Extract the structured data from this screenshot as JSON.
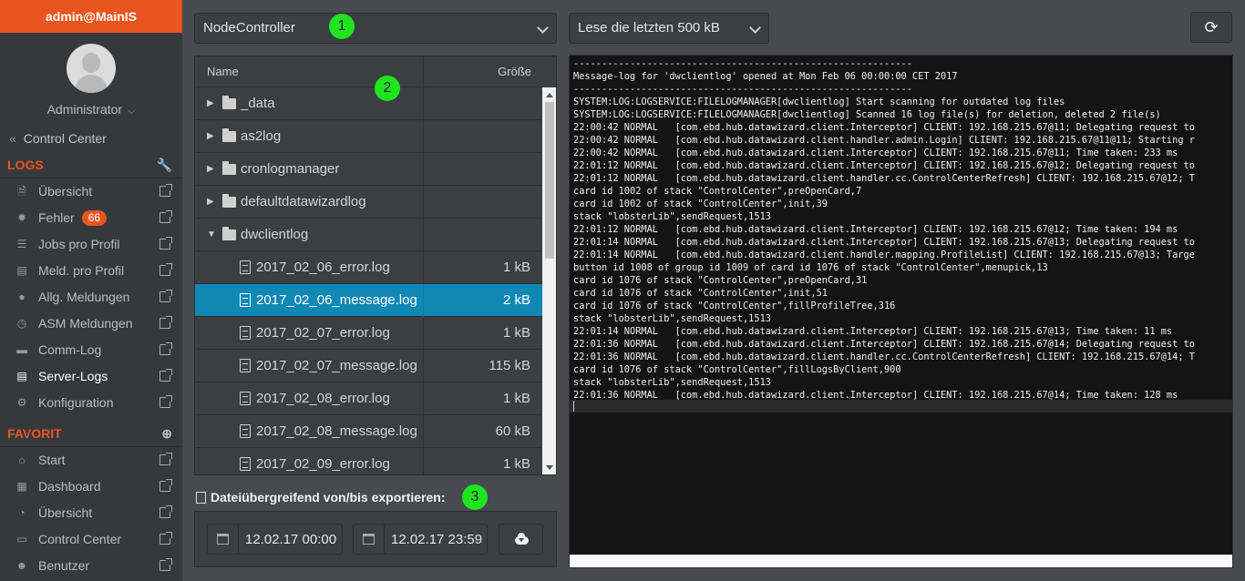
{
  "sidebar": {
    "user": "admin@MainIS",
    "role": "Administrator",
    "control_center": "Control Center",
    "sections": {
      "logs": "LOGS",
      "favorit": "FAVORIT"
    },
    "logs_items": [
      {
        "label": "Übersicht",
        "icon": "file-icon"
      },
      {
        "label": "Fehler",
        "icon": "bug-icon",
        "badge": "66"
      },
      {
        "label": "Jobs pro Profil",
        "icon": "page-icon"
      },
      {
        "label": "Meld. pro Profil",
        "icon": "book-icon"
      },
      {
        "label": "Allg. Meldungen",
        "icon": "globe-icon"
      },
      {
        "label": "ASM Meldungen",
        "icon": "clock-icon"
      },
      {
        "label": "Comm-Log",
        "icon": "database-icon"
      },
      {
        "label": "Server-Logs",
        "icon": "document-icon"
      },
      {
        "label": "Konfiguration",
        "icon": "cogs-icon"
      }
    ],
    "favorit_items": [
      {
        "label": "Start",
        "icon": "home-icon"
      },
      {
        "label": "Dashboard",
        "icon": "grid-icon"
      },
      {
        "label": "Übersicht",
        "icon": "pie-icon"
      },
      {
        "label": "Control Center",
        "icon": "monitor-icon"
      },
      {
        "label": "Benutzer",
        "icon": "users-icon"
      }
    ]
  },
  "toolbar": {
    "node_select": "NodeController",
    "read_select": "Lese die letzten 500 kB",
    "refresh_icon": "refresh-icon"
  },
  "annotations": [
    "1",
    "2",
    "3"
  ],
  "file_table": {
    "col_name": "Name",
    "col_size": "Größe",
    "rows": [
      {
        "type": "folder",
        "name": "_data",
        "size": ""
      },
      {
        "type": "folder",
        "name": "as2log",
        "size": ""
      },
      {
        "type": "folder",
        "name": "cronlogmanager",
        "size": ""
      },
      {
        "type": "folder",
        "name": "defaultdatawizardlog",
        "size": ""
      },
      {
        "type": "folder-open",
        "name": "dwclientlog",
        "size": ""
      },
      {
        "type": "file",
        "name": "2017_02_06_error.log",
        "size": "1 kB"
      },
      {
        "type": "file",
        "name": "2017_02_06_message.log",
        "size": "2 kB",
        "selected": true
      },
      {
        "type": "file",
        "name": "2017_02_07_error.log",
        "size": "1 kB"
      },
      {
        "type": "file",
        "name": "2017_02_07_message.log",
        "size": "115 kB"
      },
      {
        "type": "file",
        "name": "2017_02_08_error.log",
        "size": "1 kB"
      },
      {
        "type": "file",
        "name": "2017_02_08_message.log",
        "size": "60 kB"
      },
      {
        "type": "file",
        "name": "2017_02_09_error.log",
        "size": "1 kB"
      }
    ]
  },
  "export": {
    "title": "Dateiübergreifend von/bis exportieren:",
    "from_value": "12.02.17 00:00",
    "to_value": "12.02.17 23:59",
    "download_icon": "cloud-download-icon"
  },
  "log_lines": [
    "------------------------------------------------------------",
    "Message-log for 'dwclientlog' opened at Mon Feb 06 00:00:00 CET 2017",
    "------------------------------------------------------------",
    "SYSTEM:LOG:LOGSERVICE:FILELOGMANAGER[dwclientlog] Start scanning for outdated log files",
    "SYSTEM:LOG:LOGSERVICE:FILELOGMANAGER[dwclientlog] Scanned 16 log file(s) for deletion, deleted 2 file(s)",
    "22:00:42 NORMAL   [com.ebd.hub.datawizard.client.Interceptor] CLIENT: 192.168.215.67@11; Delegating request to",
    "22:00:42 NORMAL   [com.ebd.hub.datawizard.client.handler.admin.Login] CLIENT: 192.168.215.67@11@11; Starting r",
    "22:00:42 NORMAL   [com.ebd.hub.datawizard.client.Interceptor] CLIENT: 192.168.215.67@11; Time taken: 233 ms",
    "22:01:12 NORMAL   [com.ebd.hub.datawizard.client.Interceptor] CLIENT: 192.168.215.67@12; Delegating request to",
    "22:01:12 NORMAL   [com.ebd.hub.datawizard.client.handler.cc.ControlCenterRefresh] CLIENT: 192.168.215.67@12; T",
    "card id 1002 of stack \"ControlCenter\",preOpenCard,7",
    "card id 1002 of stack \"ControlCenter\",init,39",
    "stack \"lobsterLib\",sendRequest,1513",
    "22:01:12 NORMAL   [com.ebd.hub.datawizard.client.Interceptor] CLIENT: 192.168.215.67@12; Time taken: 194 ms",
    "22:01:14 NORMAL   [com.ebd.hub.datawizard.client.Interceptor] CLIENT: 192.168.215.67@13; Delegating request to",
    "22:01:14 NORMAL   [com.ebd.hub.datawizard.client.handler.mapping.ProfileList] CLIENT: 192.168.215.67@13; Targe",
    "button id 1008 of group id 1009 of card id 1076 of stack \"ControlCenter\",menupick,13",
    "card id 1076 of stack \"ControlCenter\",preOpenCard,31",
    "card id 1076 of stack \"ControlCenter\",init,51",
    "card id 1076 of stack \"ControlCenter\",fillProfileTree,316",
    "stack \"lobsterLib\",sendRequest,1513",
    "22:01:14 NORMAL   [com.ebd.hub.datawizard.client.Interceptor] CLIENT: 192.168.215.67@13; Time taken: 11 ms",
    "22:01:36 NORMAL   [com.ebd.hub.datawizard.client.Interceptor] CLIENT: 192.168.215.67@14; Delegating request to",
    "22:01:36 NORMAL   [com.ebd.hub.datawizard.client.handler.cc.ControlCenterRefresh] CLIENT: 192.168.215.67@14; T",
    "card id 1076 of stack \"ControlCenter\",fillLogsByClient,900",
    "stack \"lobsterLib\",sendRequest,1513",
    "22:01:36 NORMAL   [com.ebd.hub.datawizard.client.Interceptor] CLIENT: 192.168.215.67@14; Time taken: 128 ms"
  ]
}
